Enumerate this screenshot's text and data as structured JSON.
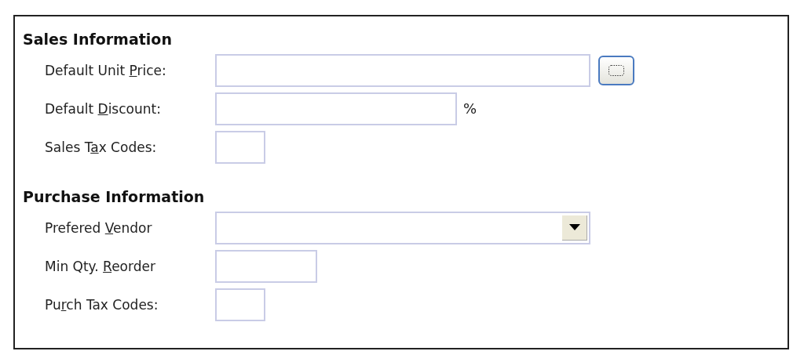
{
  "sections": [
    {
      "title": "Sales Information",
      "fields": [
        {
          "kind": "browse",
          "label_before": "Default Unit ",
          "access_key": "P",
          "label_after": "rice:"
        },
        {
          "kind": "suffix",
          "label_before": "Default ",
          "access_key": "D",
          "label_after": "iscount:",
          "suffix": "%"
        },
        {
          "kind": "text",
          "label_before": "Sales T",
          "access_key": "a",
          "label_after": "x Codes:"
        }
      ]
    },
    {
      "title": "Purchase Information",
      "fields": [
        {
          "kind": "dropdown",
          "label_before": "Prefered ",
          "access_key": "V",
          "label_after": "endor"
        },
        {
          "kind": "text",
          "label_before": "Min Qty. ",
          "access_key": "R",
          "label_after": "eorder"
        },
        {
          "kind": "text",
          "label_before": "Pu",
          "access_key": "r",
          "label_after": "ch Tax Codes:"
        }
      ]
    }
  ]
}
